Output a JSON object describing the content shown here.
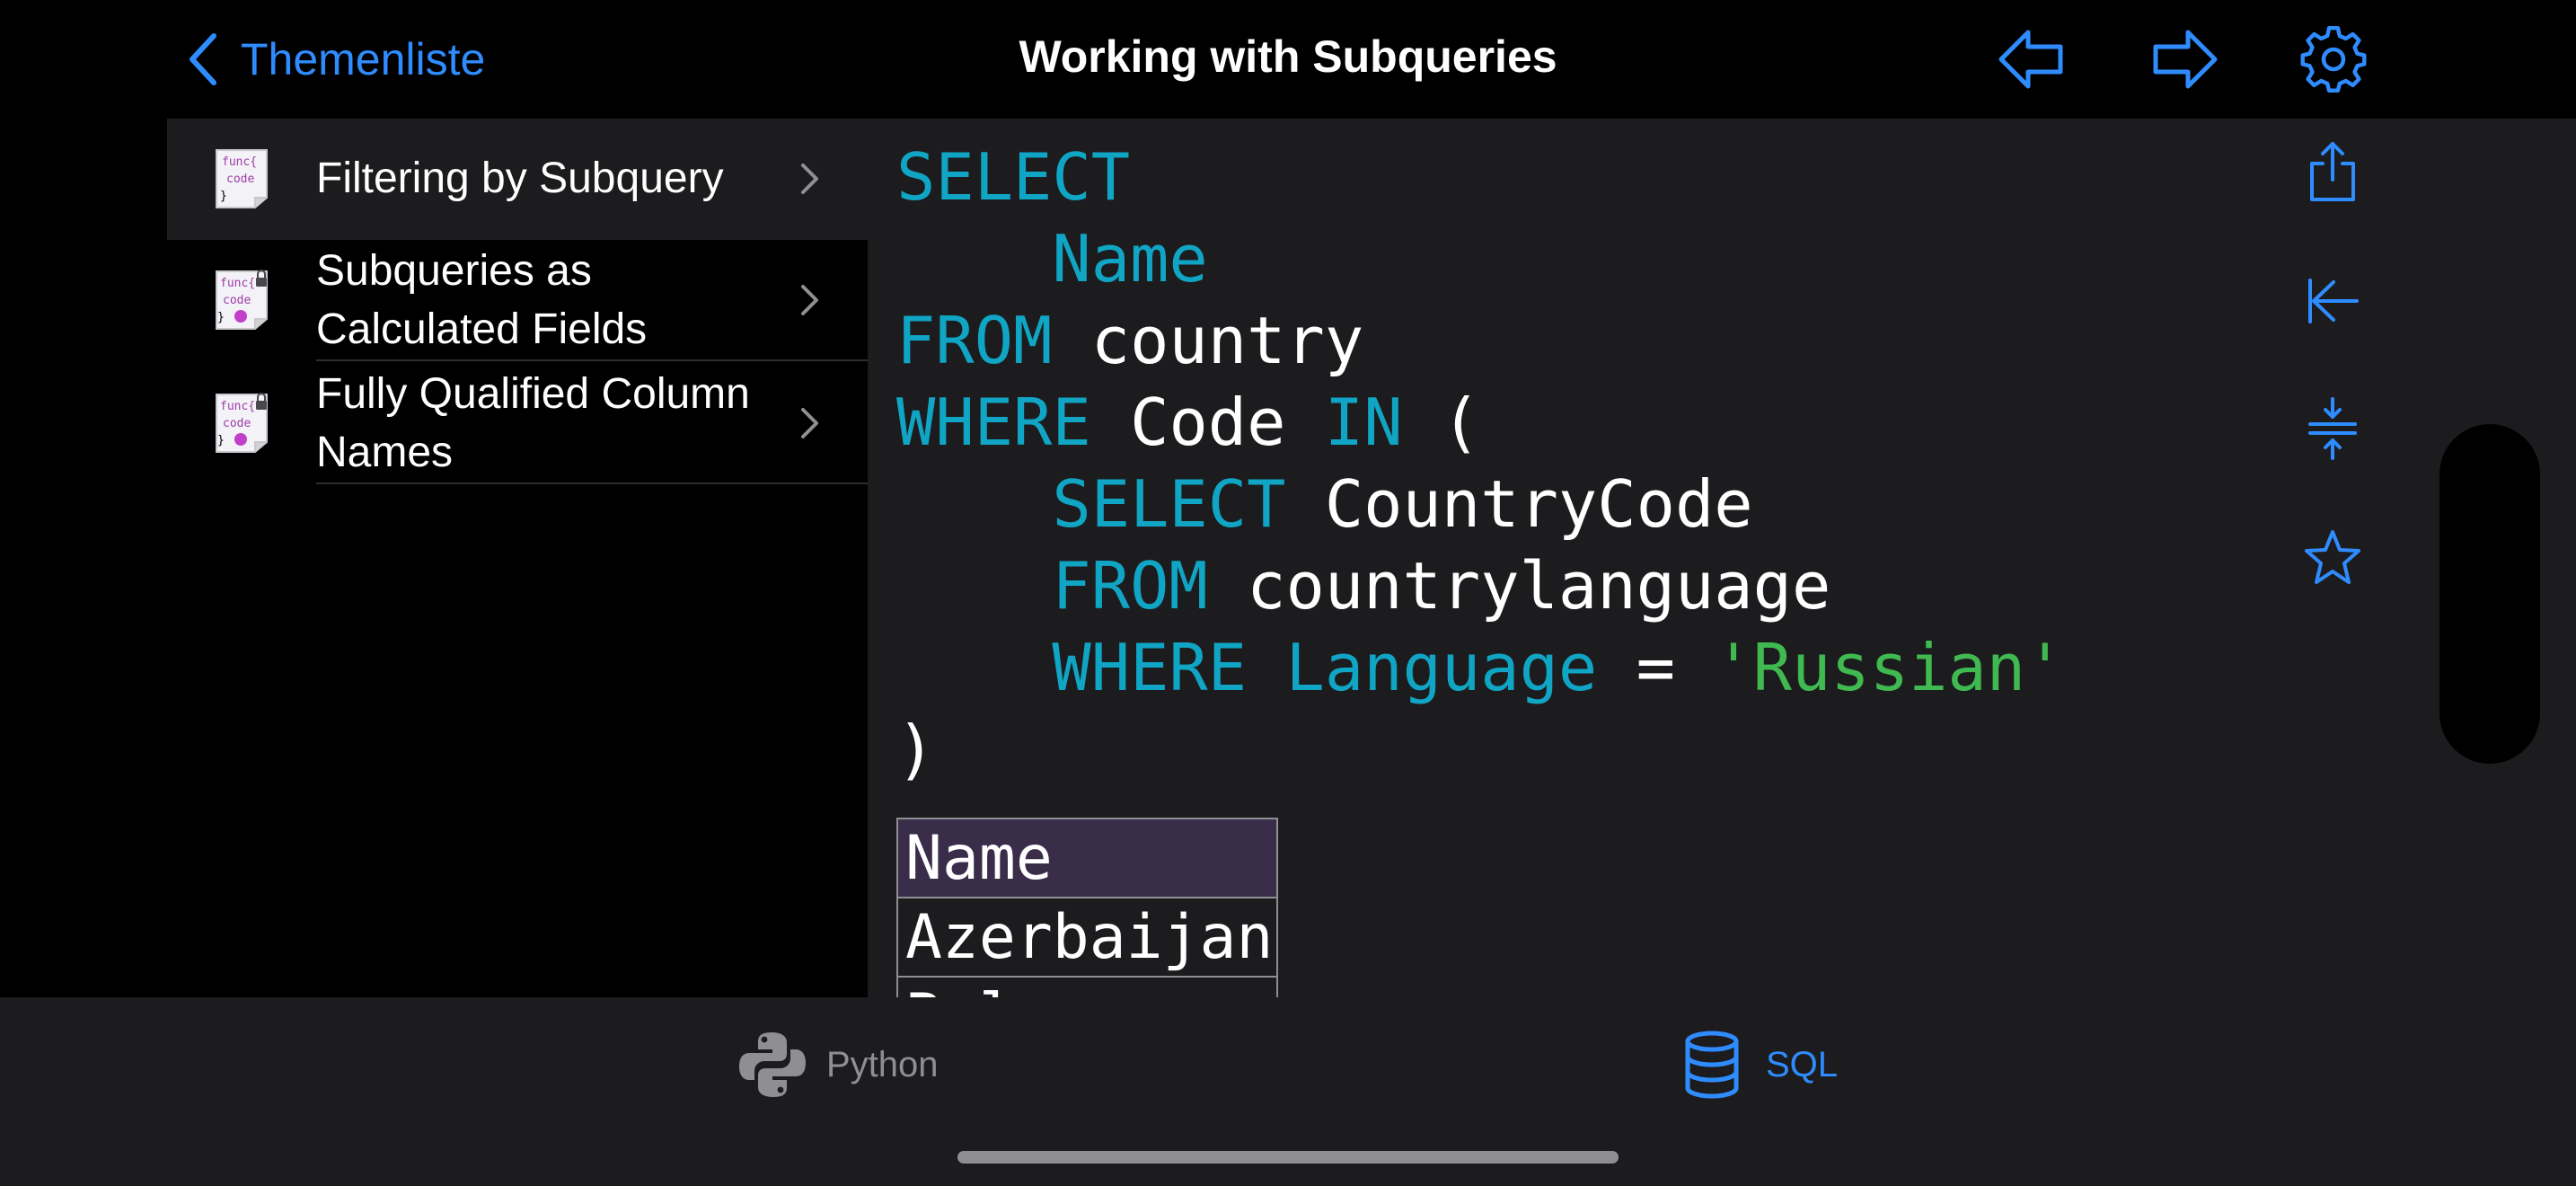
{
  "header": {
    "back_label": "Themenliste",
    "title": "Working with Subqueries",
    "buttons": [
      "previous-arrow-icon",
      "next-arrow-icon",
      "gear-icon"
    ]
  },
  "sidebar": {
    "items": [
      {
        "label_lines": [
          "Filtering by Subquery"
        ],
        "icon": "code-document-icon",
        "selected": true,
        "locked": false
      },
      {
        "label_lines": [
          "Subqueries as",
          "Calculated Fields"
        ],
        "icon": "code-document-locked-icon",
        "selected": false,
        "locked": true
      },
      {
        "label_lines": [
          "Fully Qualified Column",
          "Names"
        ],
        "icon": "code-document-locked-icon",
        "selected": false,
        "locked": true
      }
    ],
    "doc_icon_text": [
      "func{",
      "code",
      "}"
    ]
  },
  "code": {
    "lines": [
      [
        {
          "t": "SELECT",
          "k": "kw"
        }
      ],
      [
        {
          "t": "    "
        },
        {
          "t": "Name",
          "k": "kw"
        }
      ],
      [
        {
          "t": "FROM",
          "k": "kw"
        },
        {
          "t": " country"
        }
      ],
      [
        {
          "t": "WHERE",
          "k": "kw"
        },
        {
          "t": " Code "
        },
        {
          "t": "IN",
          "k": "kw"
        },
        {
          "t": " ("
        }
      ],
      [
        {
          "t": "    "
        },
        {
          "t": "SELECT",
          "k": "kw"
        },
        {
          "t": " CountryCode"
        }
      ],
      [
        {
          "t": "    "
        },
        {
          "t": "FROM",
          "k": "kw"
        },
        {
          "t": " countrylanguage"
        }
      ],
      [
        {
          "t": "    "
        },
        {
          "t": "WHERE",
          "k": "kw"
        },
        {
          "t": " "
        },
        {
          "t": "Language",
          "k": "kw"
        },
        {
          "t": " = "
        },
        {
          "t": "'Russian'",
          "k": "str"
        }
      ],
      [
        {
          "t": ")"
        }
      ]
    ]
  },
  "result": {
    "header": "Name",
    "rows": [
      "Azerbaijan",
      "Belarus"
    ]
  },
  "side_tools": [
    "share-icon",
    "collapse-left-icon",
    "compress-vertical-icon",
    "star-icon"
  ],
  "tabs": [
    {
      "label": "Python",
      "icon": "python-logo-icon",
      "active": false
    },
    {
      "label": "SQL",
      "icon": "database-icon",
      "active": true
    }
  ],
  "colors": {
    "accent": "#2f8cff",
    "keyword": "#10a5c4",
    "string": "#3fb950",
    "inactive_tab": "#8e8e93",
    "header_cell": "#3a2d4a",
    "doc_text": "#a03ca8"
  }
}
